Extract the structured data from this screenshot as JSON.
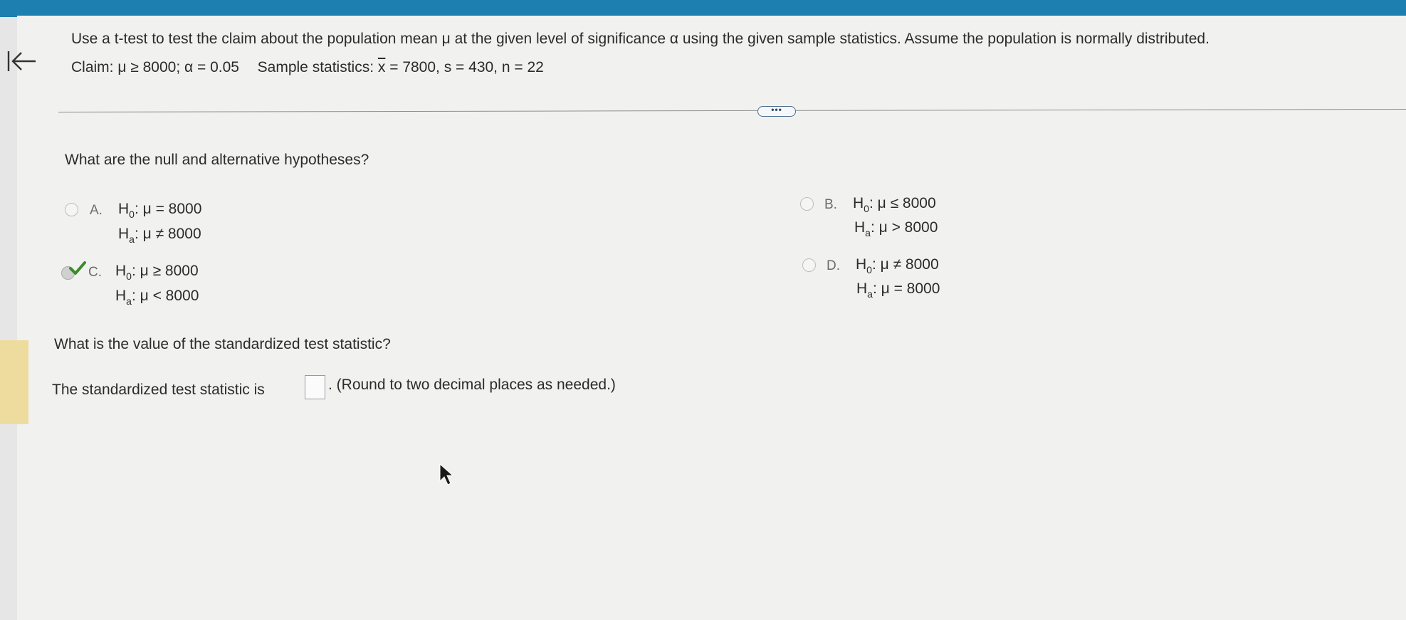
{
  "question": {
    "instructions": "Use a t-test to test the claim about the population mean μ at the given level of significance α using the given sample statistics. Assume the population is normally distributed.",
    "claim": "Claim: μ ≥ 8000; α = 0.05",
    "sample_prefix": "Sample statistics: ",
    "xbar_symbol": "x",
    "sample_rest": " = 7800, s = 430, n = 22"
  },
  "part1": {
    "prompt": "What are the null and alternative hypotheses?",
    "options": [
      {
        "letter": "A.",
        "h0_prefix": "H",
        "h0_sub": "0",
        "h0_rest": ": μ = 8000",
        "ha_prefix": "H",
        "ha_sub": "a",
        "ha_rest": ": μ ≠ 8000",
        "selected": false
      },
      {
        "letter": "B.",
        "h0_prefix": "H",
        "h0_sub": "0",
        "h0_rest": ": μ ≤ 8000",
        "ha_prefix": "H",
        "ha_sub": "a",
        "ha_rest": ": μ > 8000",
        "selected": false
      },
      {
        "letter": "C.",
        "h0_prefix": "H",
        "h0_sub": "0",
        "h0_rest": ": μ ≥ 8000",
        "ha_prefix": "H",
        "ha_sub": "a",
        "ha_rest": ": μ < 8000",
        "selected": true
      },
      {
        "letter": "D.",
        "h0_prefix": "H",
        "h0_sub": "0",
        "h0_rest": ": μ ≠ 8000",
        "ha_prefix": "H",
        "ha_sub": "a",
        "ha_rest": ": μ = 8000",
        "selected": false
      }
    ]
  },
  "part2": {
    "prompt": "What is the value of the standardized test statistic?",
    "answer_prefix": "The standardized test statistic is",
    "answer_value": "",
    "answer_suffix": ". (Round to two decimal places as needed.)"
  },
  "more_button_label": "•••",
  "icons": {
    "back": "arrow-left-to-bar-icon",
    "correct": "checkmark-icon",
    "cursor": "mouse-pointer-icon",
    "more": "ellipsis-icon"
  },
  "colors": {
    "top_bar": "#1d7fb0",
    "check": "#3c8a2a",
    "side_tab": "#eedc9f"
  }
}
